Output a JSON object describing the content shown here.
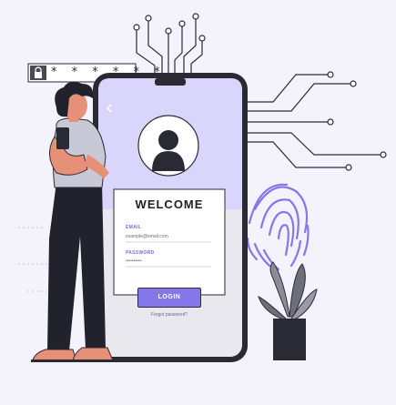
{
  "login": {
    "title": "WELCOME",
    "email_label": "EMAIL",
    "email_value": "example@email.com",
    "password_label": "PASSWORD",
    "password_value": "••••••••••",
    "button_label": "LOGIN",
    "forgot_link": "Forgot password?"
  },
  "password_bubble": {
    "masked": "* * * * * *"
  },
  "colors": {
    "background": "#f4f3fb",
    "accent": "#8577ea",
    "screen_top": "#d9d5fb",
    "outline": "#2a2a3a"
  }
}
